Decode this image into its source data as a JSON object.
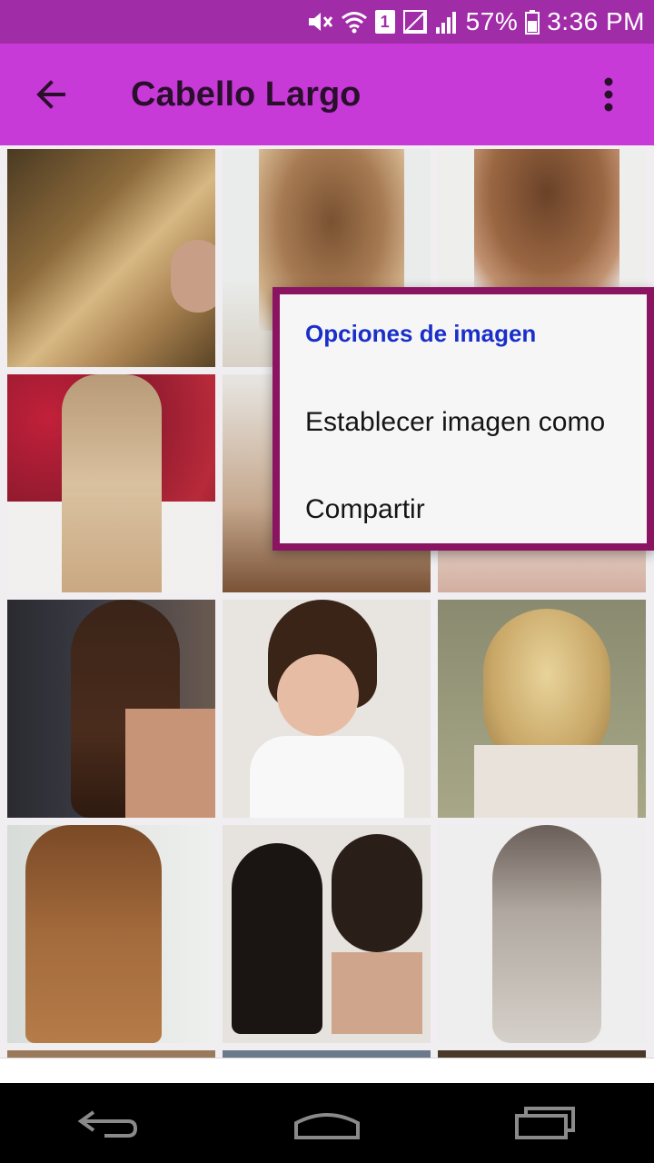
{
  "status_bar": {
    "sim_label": "1",
    "battery_percent": "57%",
    "time": "3:36 PM"
  },
  "app_bar": {
    "title": "Cabello Largo",
    "back_icon": "arrow-back-icon",
    "more_icon": "more-vert-icon"
  },
  "popup": {
    "title": "Opciones de imagen",
    "items": [
      "Establecer imagen como",
      "Compartir"
    ]
  },
  "colors": {
    "status_bar": "#a12ca8",
    "app_bar": "#c83ad8",
    "popup_border": "#8a1462",
    "popup_title": "#1a2fc9"
  },
  "gallery": {
    "images": [
      {
        "icon": "hairstyle-photo-1"
      },
      {
        "icon": "hairstyle-photo-2"
      },
      {
        "icon": "hairstyle-photo-3"
      },
      {
        "icon": "hairstyle-photo-4"
      },
      {
        "icon": "hairstyle-photo-5"
      },
      {
        "icon": "hairstyle-photo-6"
      },
      {
        "icon": "hairstyle-photo-7"
      },
      {
        "icon": "hairstyle-photo-8"
      },
      {
        "icon": "hairstyle-photo-9"
      },
      {
        "icon": "hairstyle-photo-10"
      },
      {
        "icon": "hairstyle-photo-11"
      },
      {
        "icon": "hairstyle-photo-12"
      }
    ]
  },
  "nav_bar": {
    "back_icon": "nav-back-icon",
    "home_icon": "nav-home-icon",
    "recents_icon": "nav-recents-icon"
  }
}
